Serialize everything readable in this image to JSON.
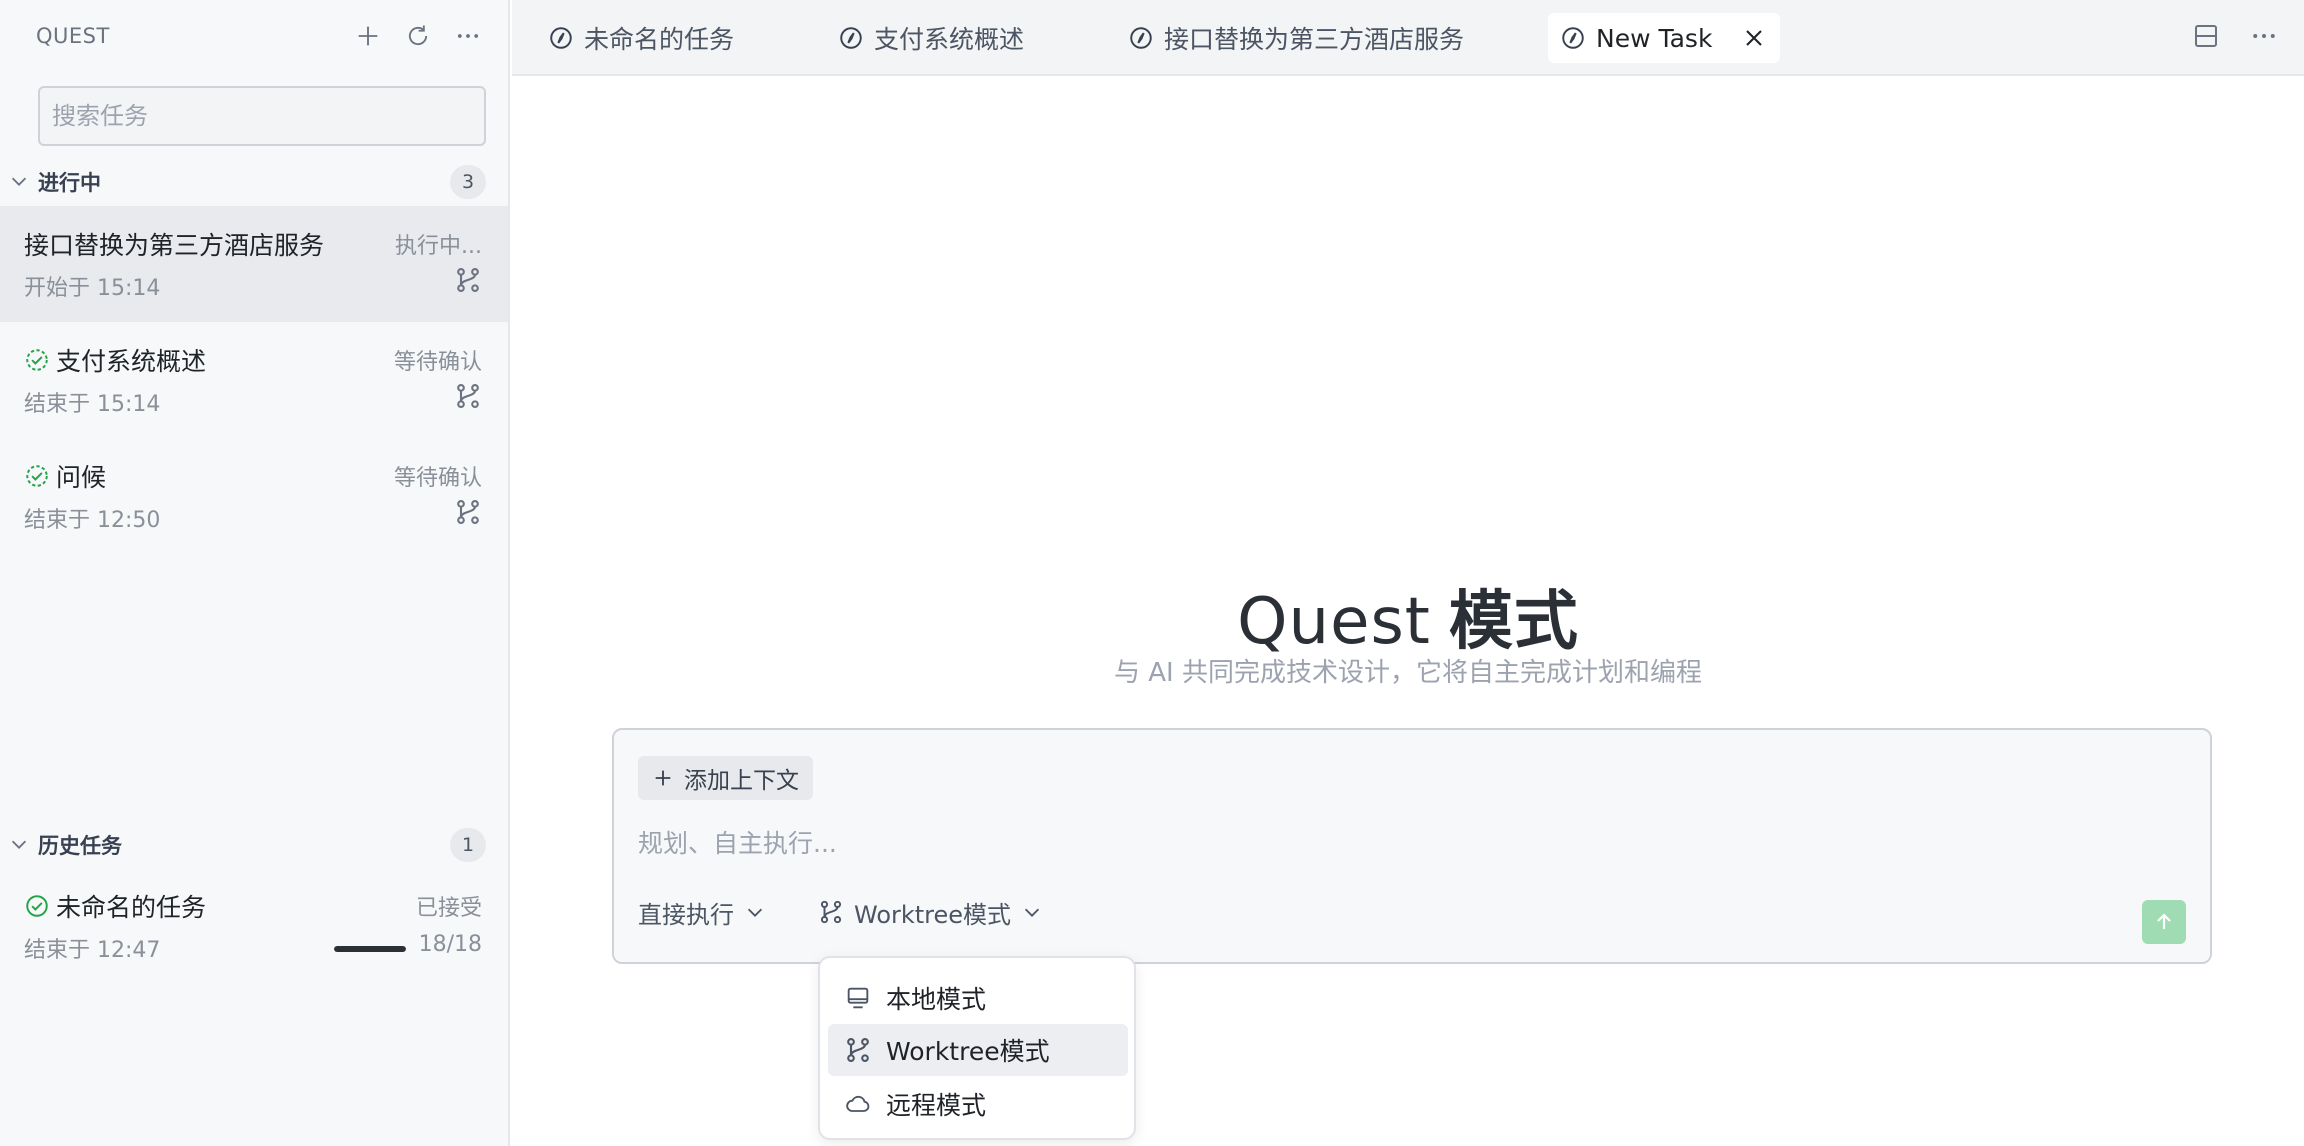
{
  "sidebar": {
    "title": "QUEST",
    "search_placeholder": "搜索任务",
    "in_progress": {
      "label": "进行中",
      "count": "3",
      "items": [
        {
          "title": "接口替换为第三方酒店服务",
          "status": "执行中...",
          "sub": "开始于 15:14",
          "icon": "none"
        },
        {
          "title": "支付系统概述",
          "status": "等待确认",
          "sub": "结束于 15:14",
          "icon": "dashed-check-icon"
        },
        {
          "title": "问候",
          "status": "等待确认",
          "sub": "结束于 12:50",
          "icon": "dashed-check-icon"
        }
      ]
    },
    "history": {
      "label": "历史任务",
      "count": "1",
      "items": [
        {
          "title": "未命名的任务",
          "status": "已接受",
          "sub": "结束于 12:47",
          "progress_text": "18/18",
          "progress": 1.0,
          "icon": "check-circle-icon"
        }
      ]
    }
  },
  "tabs": [
    {
      "label": "未命名的任务",
      "active": false
    },
    {
      "label": "支付系统概述",
      "active": false
    },
    {
      "label": "接口替换为第三方酒店服务",
      "active": false
    },
    {
      "label": "New Task",
      "active": true
    }
  ],
  "main": {
    "title_left": "Quest",
    "title_right": "模式",
    "subtitle": "与 AI 共同完成技术设计，它将自主完成计划和编程",
    "composer": {
      "add_context": "添加上下文",
      "placeholder": "规划、自主执行...",
      "exec_mode": "直接执行",
      "env_mode": "Worktree模式"
    },
    "env_menu": [
      {
        "label": "本地模式",
        "icon": "monitor-icon",
        "selected": false
      },
      {
        "label": "Worktree模式",
        "icon": "branch-icon",
        "selected": true
      },
      {
        "label": "远程模式",
        "icon": "cloud-icon",
        "selected": false
      }
    ]
  },
  "colors": {
    "accent_green": "#22a447",
    "send_button": "#9fdcb3"
  }
}
